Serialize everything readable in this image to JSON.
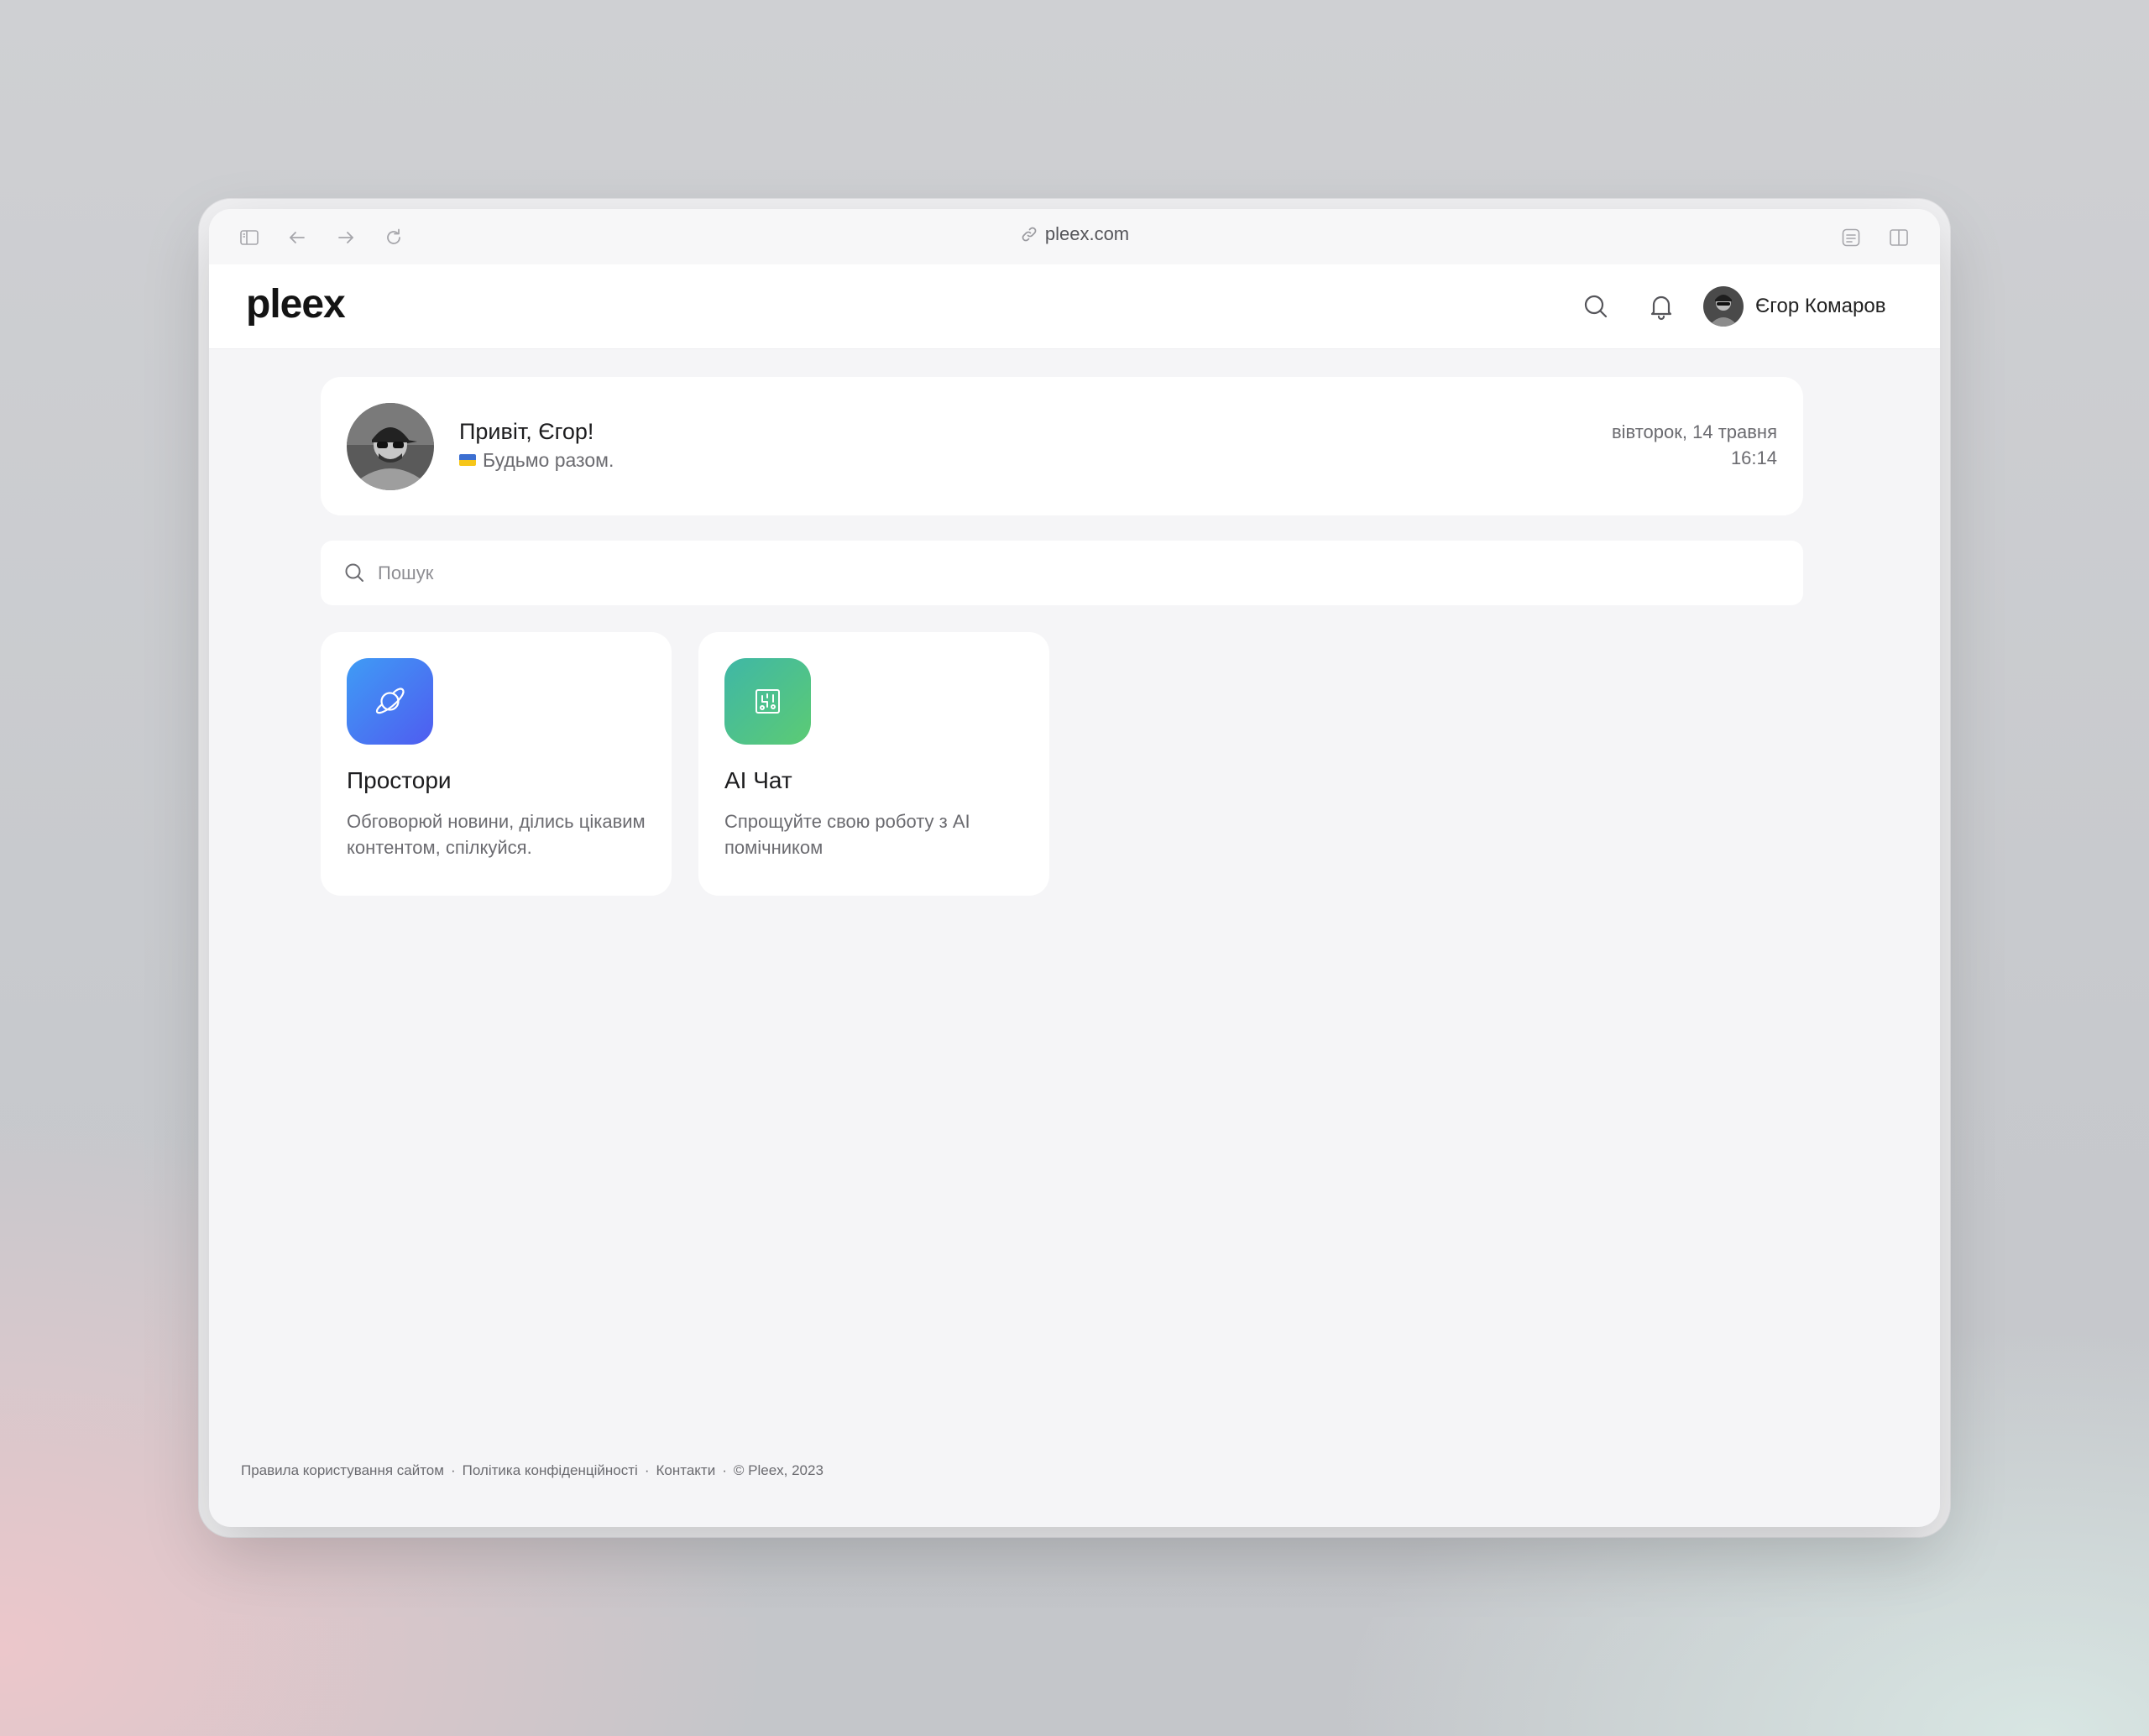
{
  "browser": {
    "url": "pleex.com",
    "icons": [
      "sidebar-icon",
      "back-icon",
      "forward-icon",
      "reload-icon",
      "link-icon",
      "reader-icon",
      "split-view-icon"
    ]
  },
  "header": {
    "logo": "pleex",
    "user_name": "Єгор Комаров"
  },
  "greeting": {
    "title": "Привіт, Єгор!",
    "subtitle": "Будьмо разом.",
    "date": "вівторок, 14 травня",
    "time": "16:14"
  },
  "search": {
    "placeholder": "Пошук"
  },
  "apps": [
    {
      "title": "Простори",
      "description": "Обговорюй новини, ділись цікавим контентом, спілкуйся.",
      "icon": "planet-icon",
      "gradient": [
        "#3f9cf5",
        "#4f5cf0"
      ]
    },
    {
      "title": "AI Чат",
      "description": "Спрощуйте свою роботу з AI помічником",
      "icon": "ai-chip-icon",
      "gradient": [
        "#3fb7a6",
        "#5ccb74"
      ]
    }
  ],
  "footer": {
    "terms": "Правила користування сайтом",
    "privacy": "Політика конфіденційності",
    "contacts": "Контакти",
    "copyright": "© Pleex, 2023"
  }
}
